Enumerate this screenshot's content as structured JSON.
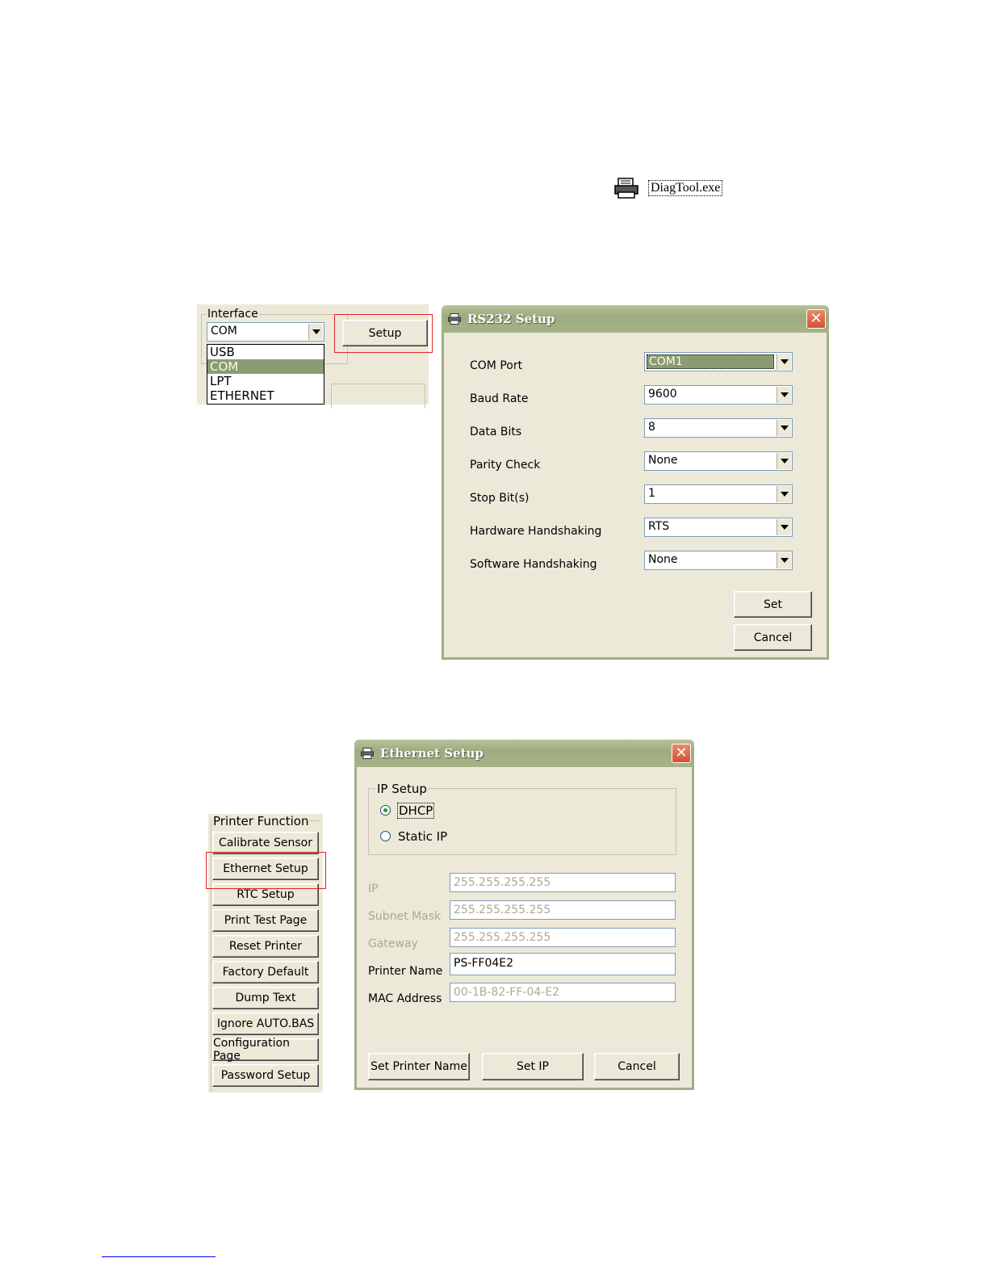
{
  "diagtool": {
    "label": "DiagTool.exe",
    "icon": "printer-icon"
  },
  "interface": {
    "legend": "Interface",
    "selected": "COM",
    "setup_label": "Setup",
    "options": [
      "USB",
      "COM",
      "LPT",
      "ETHERNET"
    ],
    "selected_option": "COM"
  },
  "rs232": {
    "title": "RS232 Setup",
    "fields": [
      {
        "label": "COM Port",
        "value": "COM1"
      },
      {
        "label": "Baud Rate",
        "value": "9600"
      },
      {
        "label": "Data Bits",
        "value": "8"
      },
      {
        "label": "Parity Check",
        "value": "None"
      },
      {
        "label": "Stop Bit(s)",
        "value": "1"
      },
      {
        "label": "Hardware Handshaking",
        "value": "RTS"
      },
      {
        "label": "Software Handshaking",
        "value": "None"
      }
    ],
    "set_label": "Set",
    "cancel_label": "Cancel"
  },
  "printer_function": {
    "legend": "Printer Function",
    "buttons": [
      "Calibrate Sensor",
      "Ethernet Setup",
      "RTC Setup",
      "Print Test Page",
      "Reset Printer",
      "Factory Default",
      "Dump Text",
      "Ignore AUTO.BAS",
      "Configuration Page",
      "Password Setup"
    ]
  },
  "ethernet": {
    "title": "Ethernet Setup",
    "ip_setup_legend": "IP Setup",
    "dhcp_label": "DHCP",
    "static_label": "Static IP",
    "mode": "DHCP",
    "fields": [
      {
        "label": "IP",
        "value": "255.255.255.255",
        "enabled": false
      },
      {
        "label": "Subnet Mask",
        "value": "255.255.255.255",
        "enabled": false
      },
      {
        "label": "Gateway",
        "value": "255.255.255.255",
        "enabled": false
      },
      {
        "label": "Printer Name",
        "value": "PS-FF04E2",
        "enabled": true
      },
      {
        "label": "MAC Address",
        "value": "00-1B-82-FF-04-E2",
        "enabled": false
      }
    ],
    "set_printer_name_label": "Set Printer Name",
    "set_ip_label": "Set IP",
    "cancel_label": "Cancel"
  },
  "colors": {
    "window_bg": "#ece9d8",
    "title_bar": "#a6b388",
    "highlight_box": "#e0232a",
    "selected_item": "#8a9b74"
  }
}
